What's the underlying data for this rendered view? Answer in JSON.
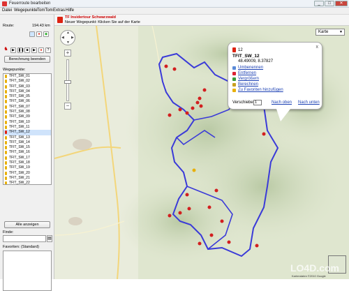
{
  "window": {
    "title": "Feuerroute bearbeiten",
    "btn_min": "_",
    "btn_max": "□",
    "btn_close": "✕"
  },
  "menu": [
    "Datei",
    "Wegepunkte",
    "TomTom",
    "Extras",
    "Hilfe"
  ],
  "route": {
    "label": "Route:",
    "distance": "194.43 km"
  },
  "calc_button": "Berechnung beenden",
  "waypoints_label": "Wegepunkte:",
  "waypoints": [
    "TFIT_SW_01",
    "TFIT_SW_02",
    "TFIT_SW_03",
    "TFIT_SW_04",
    "TFIT_SW_05",
    "TFIT_SW_06",
    "TFIT_SW_07",
    "TFIT_SW_08",
    "TFIT_SW_09",
    "TFIT_SW_10",
    "TFIT_SW_11",
    "TFIT_SW_12",
    "TFIT_SW_13",
    "TFIT_SW_14",
    "TFIT_SW_15",
    "TFIT_SW_16",
    "TFIT_SW_17",
    "TFIT_SW_18",
    "TFIT_SW_19",
    "TFIT_SW_20",
    "TFIT_SW_21",
    "TFIT_SW_22",
    "TFIT_SW_23"
  ],
  "selected_waypoint_index": 11,
  "show_all_button": "Alle anzeigen",
  "find_label": "Finde:",
  "find_value": "",
  "favorites_label": "Favoriten: (Standard)",
  "toolbar": {
    "line1": "TF Insidertour Schwarzwald",
    "line2": "Neuer Wegepunkt: Klicken Sie auf der Karte"
  },
  "map": {
    "maptype": "Karte",
    "nav_n": "▲",
    "nav_s": "▼",
    "nav_w": "◀",
    "nav_e": "▶",
    "zoom_in": "+",
    "zoom_out": "−",
    "copyright": "Kartendaten ©2010 Google",
    "watermark": "LO4D.com"
  },
  "popup": {
    "number": "12",
    "name": "TFIT_SW_12",
    "coords": "48.49009, 8.37827",
    "actions": [
      "Umbenennen",
      "Entfernen",
      "Vergrößern",
      "Berechnen",
      "Zu Favoriten hinzufügen"
    ],
    "shift_label": "Verschiebe:",
    "shift_value": "1",
    "shift_up": "Nach oben",
    "shift_down": "Nach unten",
    "close": "x"
  },
  "colors": {
    "route": "#3a3ad8",
    "marker": "#d21f1f",
    "accent_red": "#c00000"
  }
}
